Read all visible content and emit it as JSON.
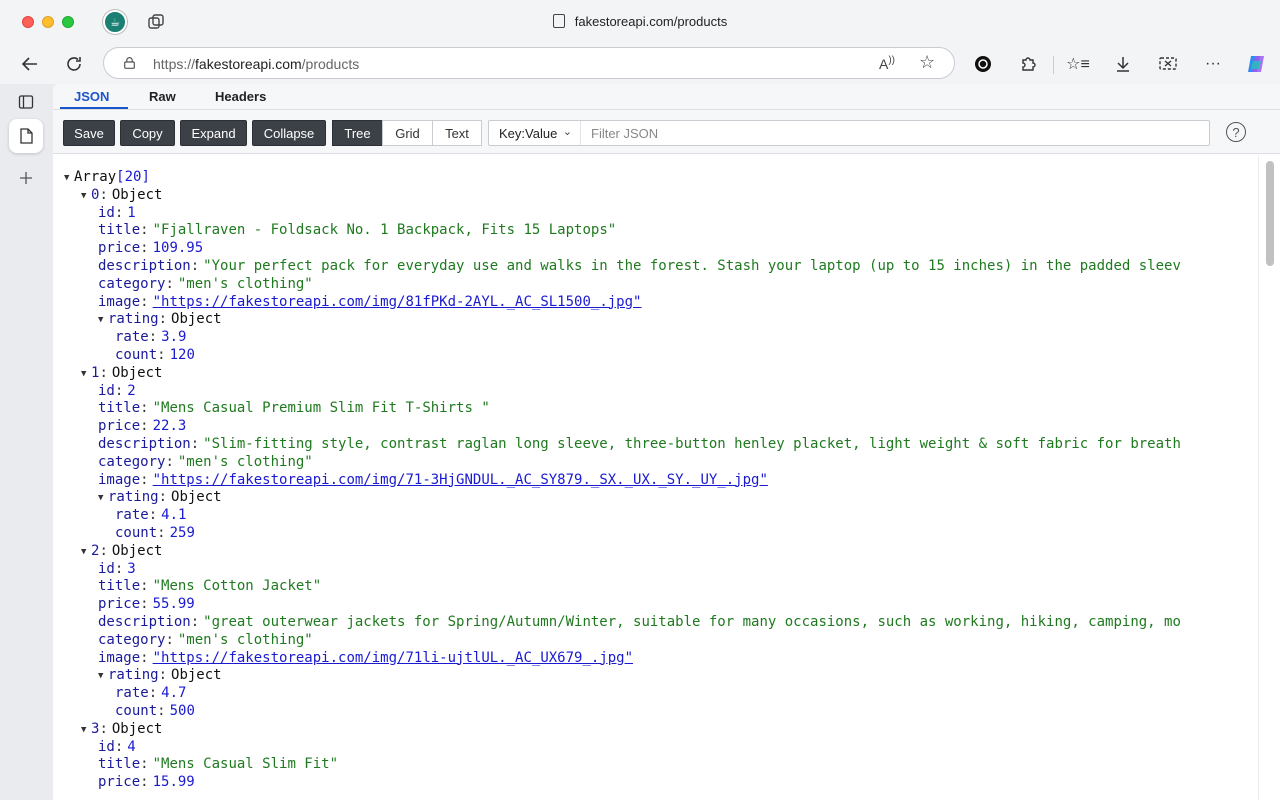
{
  "window": {
    "tab_title": "fakestoreapi.com/products"
  },
  "address_bar": {
    "url_prefix": "https://",
    "url_host": "fakestoreapi.com",
    "url_path": "/products"
  },
  "viewer_tabs": [
    {
      "label": "JSON",
      "active": true
    },
    {
      "label": "Raw",
      "active": false
    },
    {
      "label": "Headers",
      "active": false
    }
  ],
  "toolbar": {
    "save": "Save",
    "copy": "Copy",
    "expand": "Expand",
    "collapse": "Collapse",
    "tree": "Tree",
    "grid": "Grid",
    "text": "Text",
    "filter_mode": "Key:Value",
    "filter_placeholder": "Filter JSON",
    "help": "?"
  },
  "json_tree": {
    "root_label": "Array",
    "root_count": "[20]",
    "items": [
      {
        "index": "0",
        "type": "Object",
        "id": "1",
        "title": "\"Fjallraven - Foldsack No. 1 Backpack, Fits 15 Laptops\"",
        "price": "109.95",
        "description": "\"Your perfect pack for everyday use and walks in the forest. Stash your laptop (up to 15 inches) in the padded sleev",
        "category": "\"men's clothing\"",
        "image": "\"https://fakestoreapi.com/img/81fPKd-2AYL._AC_SL1500_.jpg\"",
        "rate": "3.9",
        "count": "120"
      },
      {
        "index": "1",
        "type": "Object",
        "id": "2",
        "title": "\"Mens Casual Premium Slim Fit T-Shirts \"",
        "price": "22.3",
        "description": "\"Slim-fitting style, contrast raglan long sleeve, three-button henley placket, light weight & soft fabric for breath",
        "category": "\"men's clothing\"",
        "image": "\"https://fakestoreapi.com/img/71-3HjGNDUL._AC_SY879._SX._UX._SY._UY_.jpg\"",
        "rate": "4.1",
        "count": "259"
      },
      {
        "index": "2",
        "type": "Object",
        "id": "3",
        "title": "\"Mens Cotton Jacket\"",
        "price": "55.99",
        "description": "\"great outerwear jackets for Spring/Autumn/Winter, suitable for many occasions, such as working, hiking, camping, mo",
        "category": "\"men's clothing\"",
        "image": "\"https://fakestoreapi.com/img/71li-ujtlUL._AC_UX679_.jpg\"",
        "rate": "4.7",
        "count": "500"
      },
      {
        "index": "3",
        "type": "Object",
        "id": "4",
        "title": "\"Mens Casual Slim Fit\"",
        "price": "15.99"
      }
    ]
  },
  "labels": {
    "id": "id",
    "title": "title",
    "price": "price",
    "description": "description",
    "category": "category",
    "image": "image",
    "rating": "rating",
    "rate": "rate",
    "count": "count",
    "object": "Object"
  },
  "colors": {
    "accent": "#1a55c9",
    "string": "#1f7a1f",
    "number": "#1a1ad0"
  }
}
